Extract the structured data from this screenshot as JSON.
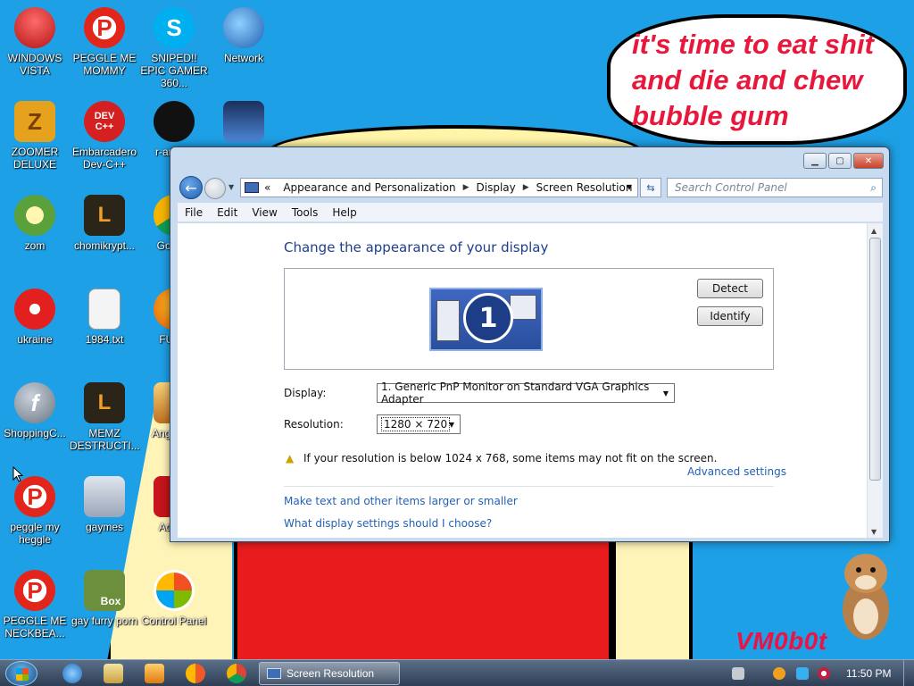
{
  "desktop": {
    "icons": [
      {
        "label": "WINDOWS VISTA",
        "icon": "toaster-icon"
      },
      {
        "label": "PEGGLE ME MOMMY",
        "icon": "peggle-icon"
      },
      {
        "label": "SNIPED!! EPIC GAMER 360...",
        "icon": "skype-icon"
      },
      {
        "label": "Network",
        "icon": "network-icon"
      },
      {
        "label": "ZOOMER DELUXE",
        "icon": "zoomer-icon"
      },
      {
        "label": "Embarcadero Dev-C++",
        "icon": "devcpp-icon"
      },
      {
        "label": "r-an par",
        "icon": "ranpar-icon"
      },
      {
        "label": "",
        "icon": "monitor-shortcut-icon"
      },
      {
        "label": "zom",
        "icon": "plant-icon"
      },
      {
        "label": "chomikrypt...",
        "icon": "chomik-icon"
      },
      {
        "label": "Go Chr",
        "icon": "chrome-icon"
      },
      {
        "label": "ukraine",
        "icon": "radiation-icon"
      },
      {
        "label": "1984.txt",
        "icon": "text-file-icon"
      },
      {
        "label": "FURR",
        "icon": "firefox-icon"
      },
      {
        "label": "ShoppingC...",
        "icon": "flash-icon"
      },
      {
        "label": "MEMZ DESTRUCTI...",
        "icon": "memz-icon"
      },
      {
        "label": "Angr Sea",
        "icon": "angry-birds-icon"
      },
      {
        "label": "peggle my heggle",
        "icon": "peggle-icon"
      },
      {
        "label": "gaymes",
        "icon": "folder-icon"
      },
      {
        "label": "Adobe",
        "icon": "adobe-icon"
      },
      {
        "label": "PEGGLE ME NECKBEA...",
        "icon": "peggle-icon"
      },
      {
        "label": "gay furry porn",
        "icon": "box-icon"
      },
      {
        "label": "Control Panel",
        "icon": "control-panel-icon"
      }
    ],
    "speech_bubble": "it's time to eat shit\nand die and chew\nbubble gum",
    "signature": "VM0b0t"
  },
  "window": {
    "title": "Screen Resolution",
    "breadcrumb": {
      "overflow": "«",
      "items": [
        "Appearance and Personalization",
        "Display",
        "Screen Resolution"
      ]
    },
    "search_placeholder": "Search Control Panel",
    "menu": [
      "File",
      "Edit",
      "View",
      "Tools",
      "Help"
    ],
    "page_title": "Change the appearance of your display",
    "monitor_number": "1",
    "detect_label": "Detect",
    "identify_label": "Identify",
    "display_label": "Display:",
    "display_value": "1. Generic PnP Monitor on Standard VGA Graphics Adapter",
    "resolution_label": "Resolution:",
    "resolution_value": "1280 × 720",
    "note": "If your resolution is below 1024 x 768, some items may not fit on the screen.",
    "advanced_settings": "Advanced settings",
    "link_text_size": "Make text and other items larger or smaller",
    "link_help": "What display settings should I choose?"
  },
  "taskbar": {
    "active_task": "Screen Resolution",
    "clock": "11:50 PM",
    "pinned": [
      "internet-explorer-icon",
      "explorer-icon",
      "media-player-icon",
      "paint-icon",
      "chrome-icon"
    ]
  },
  "colors": {
    "desktop": "#1ea0e6",
    "accent_text": "#1e3f8a",
    "link": "#2461b5",
    "bubble_text": "#e8183c"
  }
}
